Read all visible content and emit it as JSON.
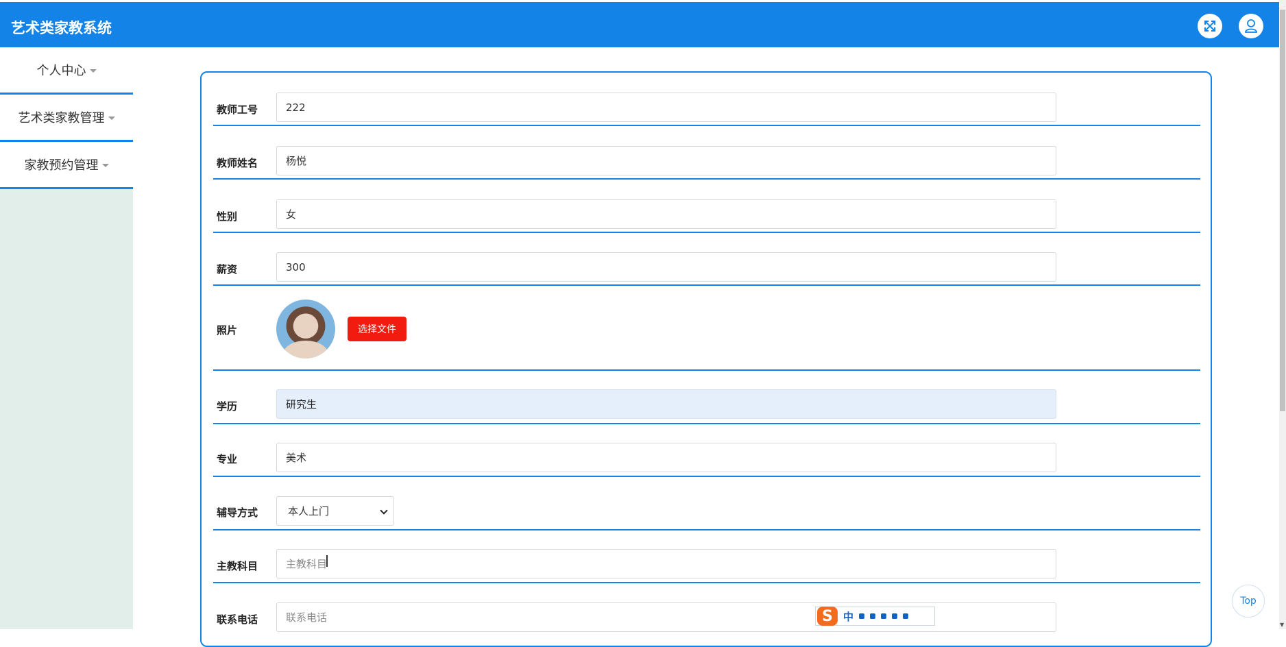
{
  "app": {
    "title": "艺术类家教系统"
  },
  "header": {
    "fullscreen_icon": "fullscreen-icon",
    "user_icon": "user-icon"
  },
  "sidebar": {
    "items": [
      {
        "label": "个人中心"
      },
      {
        "label": "艺术类家教管理"
      },
      {
        "label": "家教预约管理"
      }
    ]
  },
  "form": {
    "teacher_id": {
      "label": "教师工号",
      "value": "222"
    },
    "teacher_name": {
      "label": "教师姓名",
      "value": "杨悦"
    },
    "gender": {
      "label": "性别",
      "value": "女"
    },
    "salary": {
      "label": "薪资",
      "value": "300"
    },
    "photo": {
      "label": "照片",
      "button": "选择文件"
    },
    "education": {
      "label": "学历",
      "value": "研究生"
    },
    "major": {
      "label": "专业",
      "value": "美术"
    },
    "tutoring_mode": {
      "label": "辅导方式",
      "selected": "本人上门"
    },
    "main_subject": {
      "label": "主教科目",
      "placeholder": "主教科目"
    },
    "phone": {
      "label": "联系电话",
      "placeholder": "联系电话"
    }
  },
  "floating": {
    "top_button": "Top",
    "ime_logo": "S",
    "ime_mode": "中"
  },
  "colors": {
    "primary": "#1383e7",
    "sidebar_bg": "#e1eeea",
    "danger_button": "#f21b0f",
    "readonly_field": "#e5effb"
  }
}
